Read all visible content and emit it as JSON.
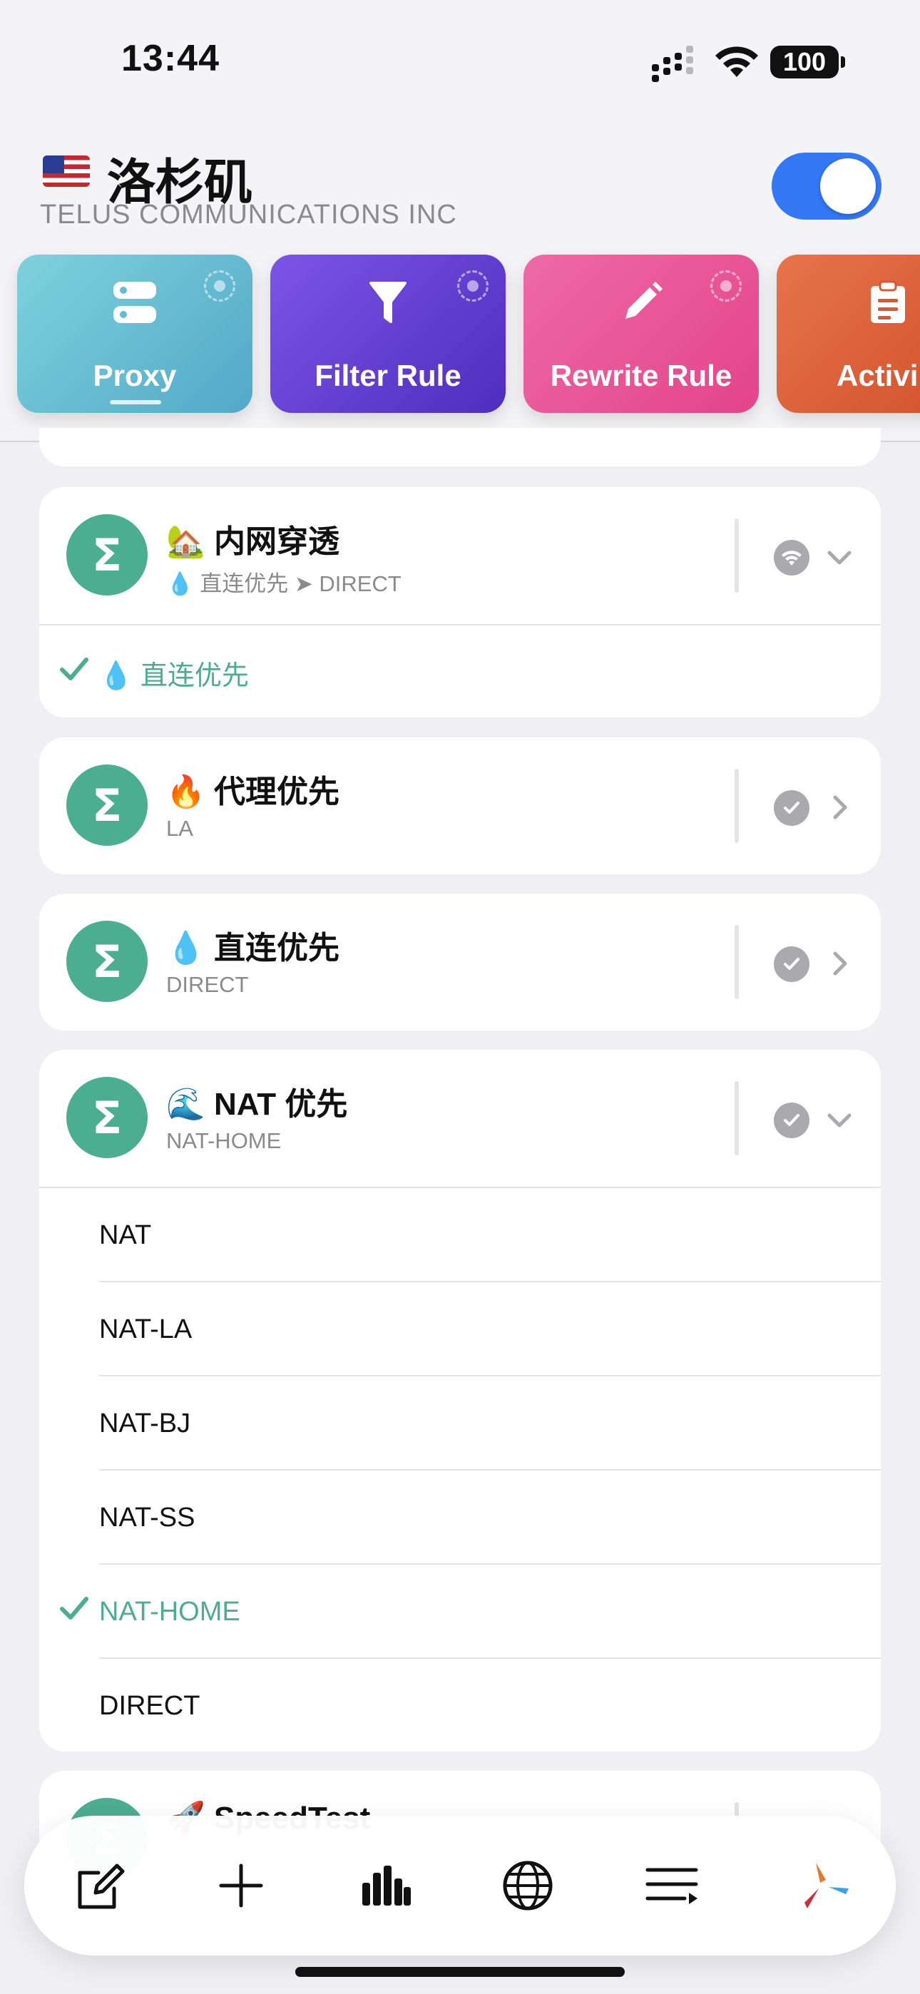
{
  "status_bar": {
    "time": "13:44",
    "battery": "100"
  },
  "header": {
    "location": "洛杉矶",
    "isp": "TELUS COMMUNICATIONS INC",
    "enabled": true
  },
  "tiles": [
    {
      "label": "Proxy",
      "icon": "server-icon",
      "active": true
    },
    {
      "label": "Filter Rule",
      "icon": "filter-icon"
    },
    {
      "label": "Rewrite Rule",
      "icon": "pencil-icon"
    },
    {
      "label": "Activi",
      "icon": "clipboard-icon"
    }
  ],
  "groups": [
    {
      "title": "🏡 内网穿透",
      "subtitle": "💧 直连优先 ➤ DIRECT",
      "status_icon": "wifi-icon",
      "expanded": true,
      "options": [
        {
          "label": "💧 直连优先",
          "selected": true
        }
      ]
    },
    {
      "title": "🔥 代理优先",
      "subtitle": "LA",
      "status_icon": "check-circle-icon",
      "expanded": false
    },
    {
      "title": "💧 直连优先",
      "subtitle": "DIRECT",
      "status_icon": "check-circle-icon",
      "expanded": false
    },
    {
      "title": "🌊 NAT 优先",
      "subtitle": "NAT-HOME",
      "status_icon": "check-circle-icon",
      "expanded": true,
      "options": [
        {
          "label": "NAT",
          "selected": false
        },
        {
          "label": "NAT-LA",
          "selected": false
        },
        {
          "label": "NAT-BJ",
          "selected": false
        },
        {
          "label": "NAT-SS",
          "selected": false
        },
        {
          "label": "NAT-HOME",
          "selected": true
        },
        {
          "label": "DIRECT",
          "selected": false
        }
      ]
    },
    {
      "title": "🚀 SpeedTest",
      "subtitle": "",
      "status_icon": "check-circle-icon",
      "expanded": false
    }
  ],
  "tabbar": [
    "edit-icon",
    "plus-icon",
    "bar-chart-icon",
    "globe-icon",
    "list-icon",
    "surge-logo-icon"
  ],
  "colors": {
    "accent": "#4cae91",
    "toggle": "#3478f6",
    "proxy": "#52a9c8",
    "filter": "#5a35c8",
    "rewrite": "#e34489",
    "activity": "#d8592f"
  }
}
